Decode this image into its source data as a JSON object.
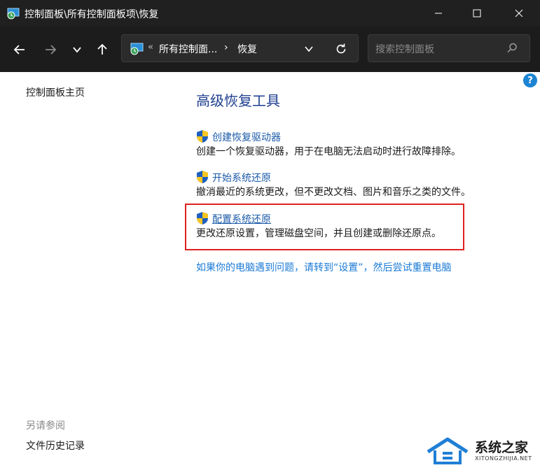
{
  "window": {
    "title": "控制面板\\所有控制面板项\\恢复"
  },
  "navigation": {
    "back_icon": "arrow-left-icon",
    "forward_icon": "arrow-right-icon",
    "recent_icon": "chevron-down-icon",
    "up_icon": "arrow-up-icon",
    "address": {
      "overflow_chevron": "«",
      "crumbs": [
        "所有控制面...",
        "恢复"
      ],
      "separator": "›"
    },
    "search": {
      "placeholder": "搜索控制面板"
    }
  },
  "sidebar": {
    "home_link": "控制面板主页",
    "see_also_heading": "另请参阅",
    "see_also_items": [
      "文件历史记录"
    ]
  },
  "main": {
    "title": "高级恢复工具",
    "tools": [
      {
        "label": "创建恢复驱动器",
        "description": "创建一个恢复驱动器，用于在电脑无法启动时进行故障排除。"
      },
      {
        "label": "开始系统还原",
        "description": "撤消最近的系统更改，但不更改文档、图片和音乐之类的文件。"
      },
      {
        "label": "配置系统还原",
        "description": "更改还原设置，管理磁盘空间，并且创建或删除还原点。"
      }
    ],
    "reset_link": "如果你的电脑遇到问题，请转到“设置”，然后尝试重置电脑"
  },
  "help_label": "?",
  "watermark": {
    "text": "系统之家",
    "subtext": "XITONGZHIJIA.NET"
  },
  "colors": {
    "title_bar": "#202020",
    "nav_bar": "#1c1c1c",
    "page_title": "#1c3d8f",
    "link": "#1a5aa8",
    "highlight": "#e02020"
  }
}
